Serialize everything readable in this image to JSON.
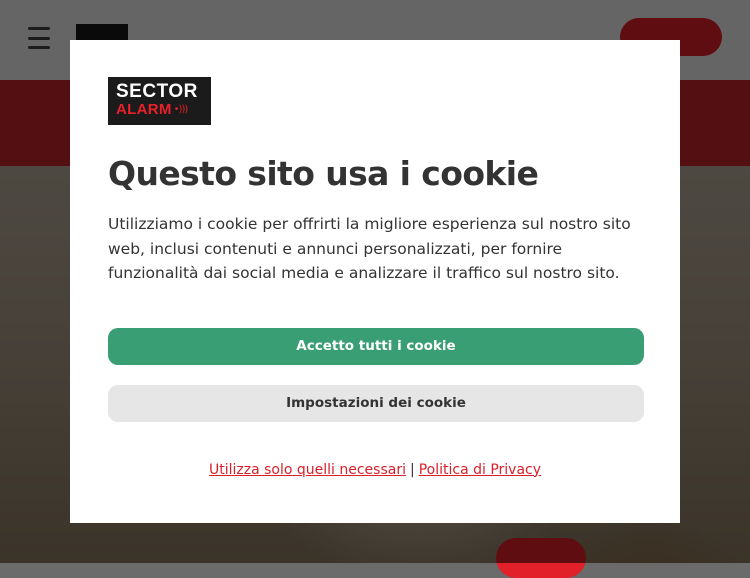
{
  "brand": {
    "logo_line1": "SECTOR",
    "logo_line2": "ALARM",
    "logo_waves": "•)))"
  },
  "cookie_modal": {
    "title": "Questo sito usa i cookie",
    "body": "Utilizziamo i cookie per offrirti la migliore esperienza sul nostro sito web, inclusi contenuti e annunci personalizzati, per fornire funzionalità dai social media e analizzare il traffico sul nostro sito.",
    "accept_all_label": "Accetto tutti i cookie",
    "settings_label": "Impostazioni dei cookie",
    "necessary_only_link": "Utilizza solo quelli necessari",
    "separator": "|",
    "privacy_link": "Politica di Privacy"
  },
  "colors": {
    "brand_red": "#e8202a",
    "accept_green": "#3a9e74",
    "link_red": "#d9202a",
    "text_dark": "#333333"
  }
}
